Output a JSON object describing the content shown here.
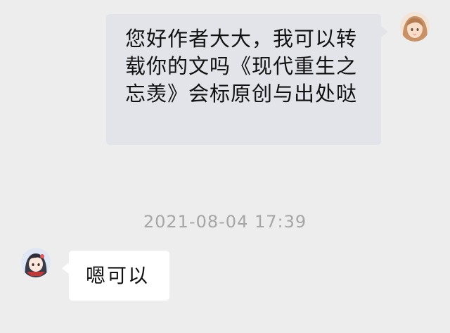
{
  "conversation": {
    "messages": [
      {
        "sender": "me",
        "avatar_icon": "girl-avatar-icon",
        "text": "您好作者大大，我可以转载你的文吗《现代重生之忘羡》会标原创与出处哒"
      },
      {
        "sender": "author",
        "avatar_icon": "anime-character-avatar-icon",
        "text": "嗯可以"
      }
    ],
    "timestamp": "2021-08-04 17:39"
  },
  "colors": {
    "background": "#ededed",
    "outgoing_bubble": "#e2e4ea",
    "incoming_bubble": "#ffffff",
    "timestamp_text": "#a6a6a6"
  }
}
